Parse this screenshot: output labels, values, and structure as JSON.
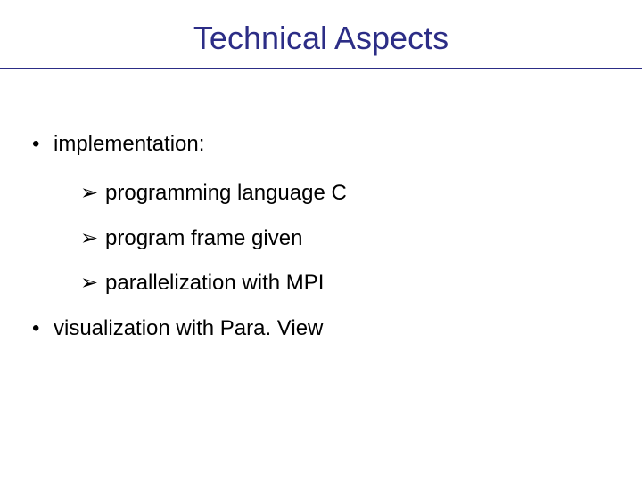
{
  "title": "Technical Aspects",
  "items": {
    "impl": {
      "label": "implementation:"
    },
    "sub": {
      "a": "programming language C",
      "b": "program frame given",
      "c": "parallelization with MPI"
    },
    "vis": {
      "label": "visualization with Para. View"
    }
  },
  "glyphs": {
    "dot": "•",
    "arrow": "➢"
  }
}
